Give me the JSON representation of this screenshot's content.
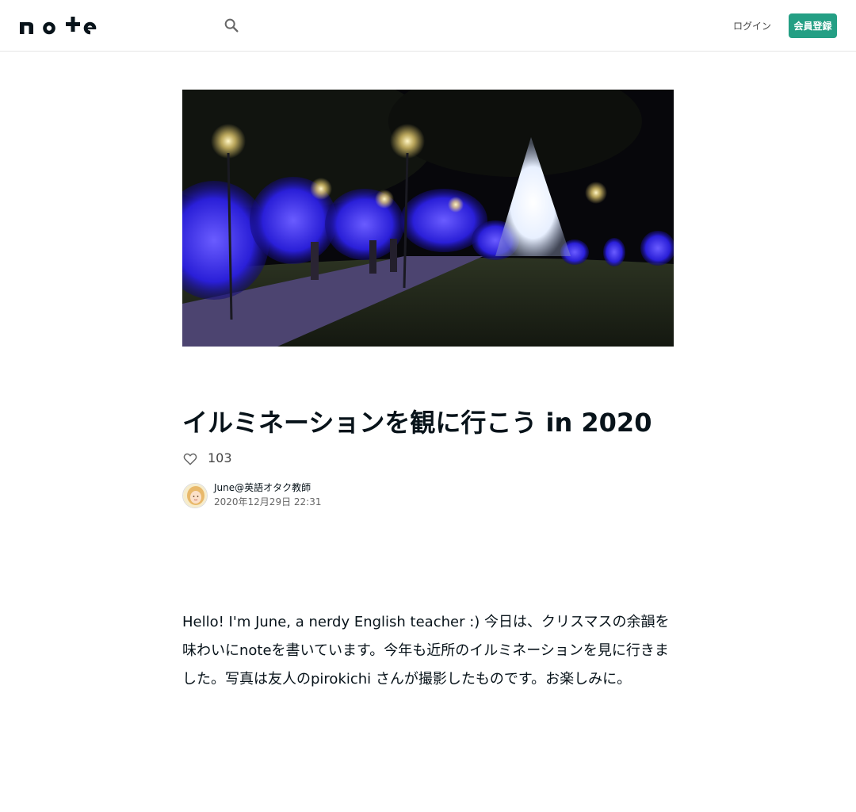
{
  "header": {
    "logo_text": "note",
    "login_label": "ログイン",
    "signup_label": "会員登録"
  },
  "article": {
    "title": "イルミネーションを観に行こう in 2020",
    "like_count": "103",
    "author_name": "June@英語オタク教師",
    "date": "2020年12月29日 22:31",
    "body": "Hello! I'm June, a nerdy English teacher :) 今日は、クリスマスの余韻を味わいにnoteを書いています。今年も近所のイルミネーションを見に行きました。写真は友人のpirokichi さんが撮影したものです。お楽しみに。"
  },
  "colors": {
    "accent": "#249f84",
    "text": "#08131a",
    "border": "#e6e6e6"
  },
  "icons": {
    "search": "search-icon",
    "like": "heart-outline-icon"
  }
}
